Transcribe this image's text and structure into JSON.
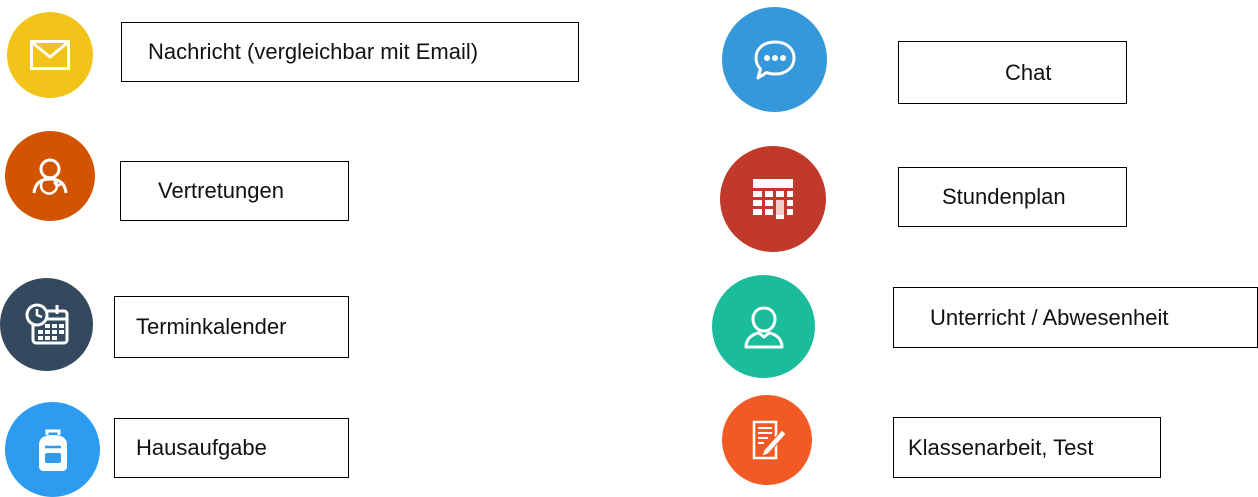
{
  "legend": {
    "left": [
      {
        "label": "Nachricht (vergleichbar mit Email)",
        "icon": "envelope-icon",
        "color": "#F2C318"
      },
      {
        "label": "Vertretungen",
        "icon": "substitute-person-icon",
        "color": "#D35400"
      },
      {
        "label": "Terminkalender",
        "icon": "calendar-clock-icon",
        "color": "#34495E"
      },
      {
        "label": "Hausaufgabe",
        "icon": "backpack-icon",
        "color": "#2D9CF0"
      }
    ],
    "right": [
      {
        "label": "Chat",
        "icon": "chat-bubble-icon",
        "color": "#3498DB"
      },
      {
        "label": "Stundenplan",
        "icon": "timetable-grid-icon",
        "color": "#C0392B"
      },
      {
        "label": "Unterricht / Abwesenheit",
        "icon": "person-icon",
        "color": "#1ABC9C"
      },
      {
        "label": "Klassenarbeit, Test",
        "icon": "exam-pencil-icon",
        "color": "#F15A24"
      }
    ]
  }
}
